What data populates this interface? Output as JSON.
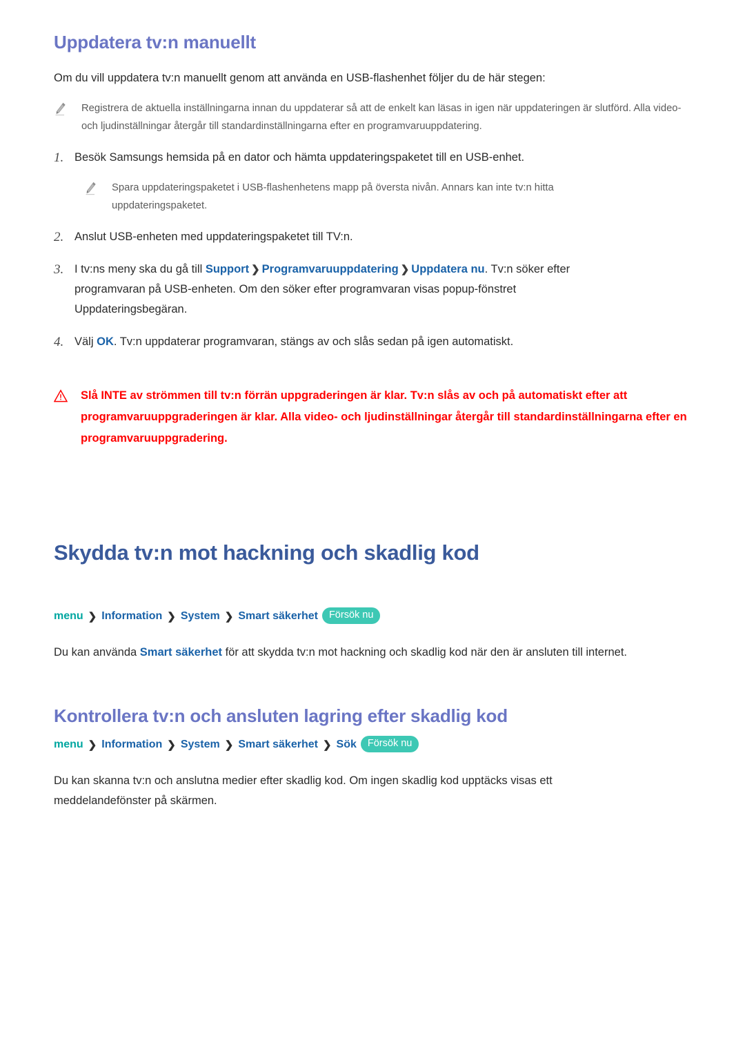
{
  "section_one": {
    "heading": "Uppdatera tv:n manuellt",
    "intro": "Om du vill uppdatera tv:n manuellt genom att använda en USB-flashenhet följer du de här stegen:",
    "note_top": "Registrera de aktuella inställningarna innan du uppdaterar så att de enkelt kan läsas in igen när uppdateringen är slutförd. Alla video- och ljudinställningar återgår till standardinställningarna efter en programvaruuppdatering.",
    "steps": [
      {
        "num": "1.",
        "text": "Besök Samsungs hemsida på en dator och hämta uppdateringspaketet till en USB-enhet."
      },
      {
        "num": "2.",
        "text": "Anslut USB-enheten med uppdateringspaketet till TV:n."
      },
      {
        "num": "3.",
        "prefix": "I tv:ns meny ska du gå till ",
        "link1": "Support",
        "link2": "Programvaruuppdatering",
        "link3": "Uppdatera nu",
        "suffix": ". Tv:n söker efter programvaran på USB-enheten. Om den söker efter programvaran visas popup-fönstret Uppdateringsbegäran."
      },
      {
        "num": "4.",
        "prefix": "Välj ",
        "link1": "OK",
        "suffix": ". Tv:n uppdaterar programvaran, stängs av och slås sedan på igen automatiskt."
      }
    ],
    "note_step1": "Spara uppdateringspaketet i USB-flashenhetens mapp på översta nivån. Annars kan inte tv:n hitta uppdateringspaketet.",
    "warning": "Slå INTE av strömmen till tv:n förrän uppgraderingen är klar. Tv:n slås av och på automatiskt efter att programvaruuppgraderingen är klar. Alla video- och ljudinställningar återgår till standardinställningarna efter en programvaruuppgradering."
  },
  "section_two": {
    "heading": "Skydda tv:n mot hackning och skadlig kod",
    "breadcrumb": {
      "menu": "menu",
      "separator": "❯",
      "items": [
        "Information",
        "System",
        "Smart säkerhet"
      ],
      "badge": "Försök nu"
    },
    "paragraph_prefix": "Du kan använda ",
    "paragraph_link": "Smart säkerhet",
    "paragraph_suffix": " för att skydda tv:n mot hackning och skadlig kod när den är ansluten till internet."
  },
  "section_three": {
    "heading": "Kontrollera tv:n och ansluten lagring efter skadlig kod",
    "breadcrumb": {
      "menu": "menu",
      "separator": "❯",
      "items": [
        "Information",
        "System",
        "Smart säkerhet",
        "Sök"
      ],
      "badge": "Försök nu"
    },
    "paragraph": "Du kan skanna tv:n och anslutna medier efter skadlig kod. Om ingen skadlig kod upptäcks visas ett meddelandefönster på skärmen."
  },
  "colors": {
    "sub_heading": "#6a75c4",
    "main_heading": "#3a5a9b",
    "link_blue": "#1a62a8",
    "teal": "#00a6a0",
    "badge_bg": "#3dc8b4",
    "warning_red": "#ff0000",
    "note_gray": "#5b5b5b"
  }
}
